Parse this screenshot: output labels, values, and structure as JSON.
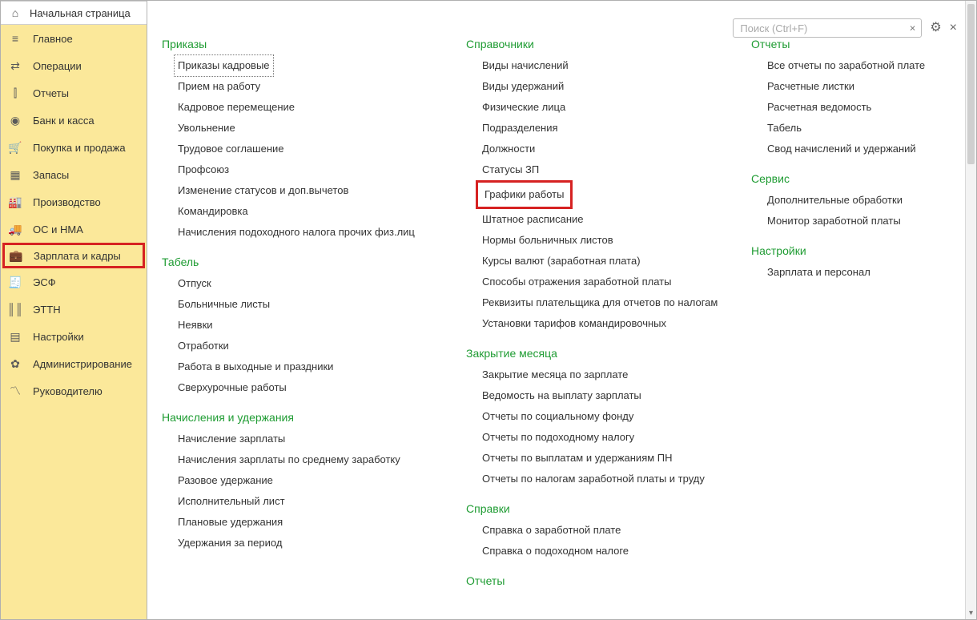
{
  "home_label": "Начальная страница",
  "sidebar": [
    {
      "icon": "≡",
      "label": "Главное",
      "name": "sidebar-item-main"
    },
    {
      "icon": "⇄",
      "label": "Операции",
      "name": "sidebar-item-operations"
    },
    {
      "icon": "⫿",
      "label": "Отчеты",
      "name": "sidebar-item-reports"
    },
    {
      "icon": "◉",
      "label": "Банк и касса",
      "name": "sidebar-item-bank"
    },
    {
      "icon": "🛒",
      "label": "Покупка и продажа",
      "name": "sidebar-item-sales"
    },
    {
      "icon": "▦",
      "label": "Запасы",
      "name": "sidebar-item-stock"
    },
    {
      "icon": "🏭",
      "label": "Производство",
      "name": "sidebar-item-production"
    },
    {
      "icon": "🚚",
      "label": "ОС и НМА",
      "name": "sidebar-item-assets"
    },
    {
      "icon": "💼",
      "label": "Зарплата и кадры",
      "name": "sidebar-item-salary",
      "highlighted": true
    },
    {
      "icon": "🧾",
      "label": "ЭСФ",
      "name": "sidebar-item-esf"
    },
    {
      "icon": "║║",
      "label": "ЭТТН",
      "name": "sidebar-item-ettn"
    },
    {
      "icon": "▤",
      "label": "Настройки",
      "name": "sidebar-item-settings"
    },
    {
      "icon": "✿",
      "label": "Администрирование",
      "name": "sidebar-item-admin"
    },
    {
      "icon": "〽",
      "label": "Руководителю",
      "name": "sidebar-item-manager"
    }
  ],
  "search_placeholder": "Поиск (Ctrl+F)",
  "columns": [
    {
      "sections": [
        {
          "title": "Приказы",
          "items": [
            {
              "label": "Приказы кадровые",
              "dotted": true
            },
            {
              "label": "Прием на работу"
            },
            {
              "label": "Кадровое перемещение"
            },
            {
              "label": "Увольнение"
            },
            {
              "label": "Трудовое соглашение"
            },
            {
              "label": "Профсоюз"
            },
            {
              "label": "Изменение статусов и доп.вычетов"
            },
            {
              "label": "Командировка"
            },
            {
              "label": "Начисления подоходного налога прочих физ.лиц"
            }
          ]
        },
        {
          "title": "Табель",
          "items": [
            {
              "label": "Отпуск"
            },
            {
              "label": "Больничные листы"
            },
            {
              "label": "Неявки"
            },
            {
              "label": "Отработки"
            },
            {
              "label": "Работа в выходные и праздники"
            },
            {
              "label": "Сверхурочные работы"
            }
          ]
        },
        {
          "title": "Начисления и удержания",
          "items": [
            {
              "label": "Начисление зарплаты"
            },
            {
              "label": "Начисления зарплаты по среднему заработку"
            },
            {
              "label": "Разовое удержание"
            },
            {
              "label": "Исполнительный лист"
            },
            {
              "label": "Плановые удержания"
            },
            {
              "label": "Удержания за период"
            }
          ]
        }
      ]
    },
    {
      "sections": [
        {
          "title": "Справочники",
          "items": [
            {
              "label": "Виды начислений"
            },
            {
              "label": "Виды удержаний"
            },
            {
              "label": "Физические лица"
            },
            {
              "label": "Подразделения"
            },
            {
              "label": "Должности"
            },
            {
              "label": "Статусы ЗП"
            },
            {
              "label": "Графики работы",
              "boxed": true
            },
            {
              "label": "Штатное расписание"
            },
            {
              "label": "Нормы больничных листов"
            },
            {
              "label": "Курсы валют (заработная плата)"
            },
            {
              "label": "Способы отражения заработной платы"
            },
            {
              "label": "Реквизиты плательщика для отчетов по налогам"
            },
            {
              "label": "Установки тарифов командировочных"
            }
          ]
        },
        {
          "title": "Закрытие месяца",
          "items": [
            {
              "label": "Закрытие месяца по зарплате"
            },
            {
              "label": "Ведомость на выплату зарплаты"
            },
            {
              "label": "Отчеты по социальному фонду"
            },
            {
              "label": "Отчеты по подоходному налогу"
            },
            {
              "label": "Отчеты по выплатам и удержаниям ПН"
            },
            {
              "label": "Отчеты по налогам заработной платы и труду"
            }
          ]
        },
        {
          "title": "Справки",
          "items": [
            {
              "label": "Справка о заработной плате"
            },
            {
              "label": "Справка о подоходном налоге"
            }
          ]
        },
        {
          "title": "Отчеты",
          "items": []
        }
      ]
    },
    {
      "sections": [
        {
          "title": "Отчеты",
          "items": [
            {
              "label": "Все отчеты по заработной плате"
            },
            {
              "label": "Расчетные листки"
            },
            {
              "label": "Расчетная ведомость"
            },
            {
              "label": "Табель"
            },
            {
              "label": "Свод начислений и удержаний"
            }
          ]
        },
        {
          "title": "Сервис",
          "items": [
            {
              "label": "Дополнительные обработки"
            },
            {
              "label": "Монитор заработной платы"
            }
          ]
        },
        {
          "title": "Настройки",
          "items": [
            {
              "label": "Зарплата и персонал"
            }
          ]
        }
      ]
    }
  ]
}
